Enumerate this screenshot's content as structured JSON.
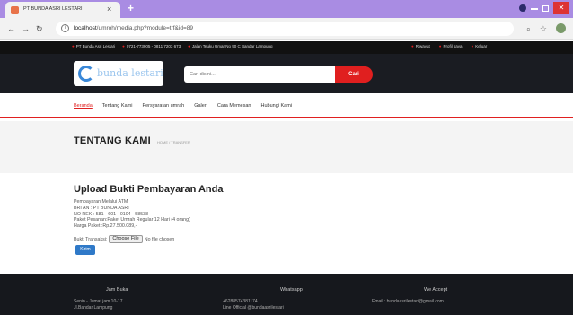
{
  "browser": {
    "tab_title": "PT BUNDA ASRI LESTARI",
    "tab_close": "×",
    "new_tab": "+",
    "url_host": "localhost",
    "url_path": "/umroh/media.php?module=trf&id=89",
    "accent": "#a98ce3"
  },
  "topbar": {
    "company": "PT Bunda Asri Lestari",
    "phone": "0721-773905 - 0811 7203 673",
    "address": "Jalan Teuku Umar No 90 C Bandar Lampung",
    "links": [
      "Riwayat",
      "Profil saya",
      "Keluar"
    ]
  },
  "header": {
    "logo_text": "bunda lestari",
    "search_placeholder": "Cari disini...",
    "search_button": "Cari",
    "brand_red": "#e01f1f"
  },
  "nav": {
    "items": [
      "Beranda",
      "Tentang Kami",
      "Persyaratan umrah",
      "Galeri",
      "Cara Memesan",
      "Hubungi Kami"
    ]
  },
  "page": {
    "title": "TENTANG KAMI",
    "breadcrumb": "HOME  /  TRANSFER"
  },
  "upload": {
    "heading": "Upload Bukti Pembayaran Anda",
    "lines": [
      "Pembayaran Melalui ATM",
      "BRI AN : PT BUNDA ASRI",
      "NO REK : 581 - 601 - 0104 - 58538",
      "Paket Pesanan:Paket Umrah Regular 12 Hari (4 orang)",
      "Harga Paket      :Rp.27.500.089,-"
    ],
    "file_label": "Bukti Transaksi:",
    "choose_file": "Choose File",
    "no_file": "No file chosen",
    "submit": "Kirim"
  },
  "footer": {
    "col1_head": "Jam Buka",
    "col1_lines": [
      "Senin - Jumat jam 10-17",
      "Jl.Bandar Lampung"
    ],
    "col2_head": "Whatsapp",
    "col2_lines": [
      "+6288574381174",
      "Line Official @bundaasrilestari"
    ],
    "col3_head": "We Accept",
    "col3_lines": [
      "Email : bundaasrilestari@gmail.com"
    ]
  }
}
